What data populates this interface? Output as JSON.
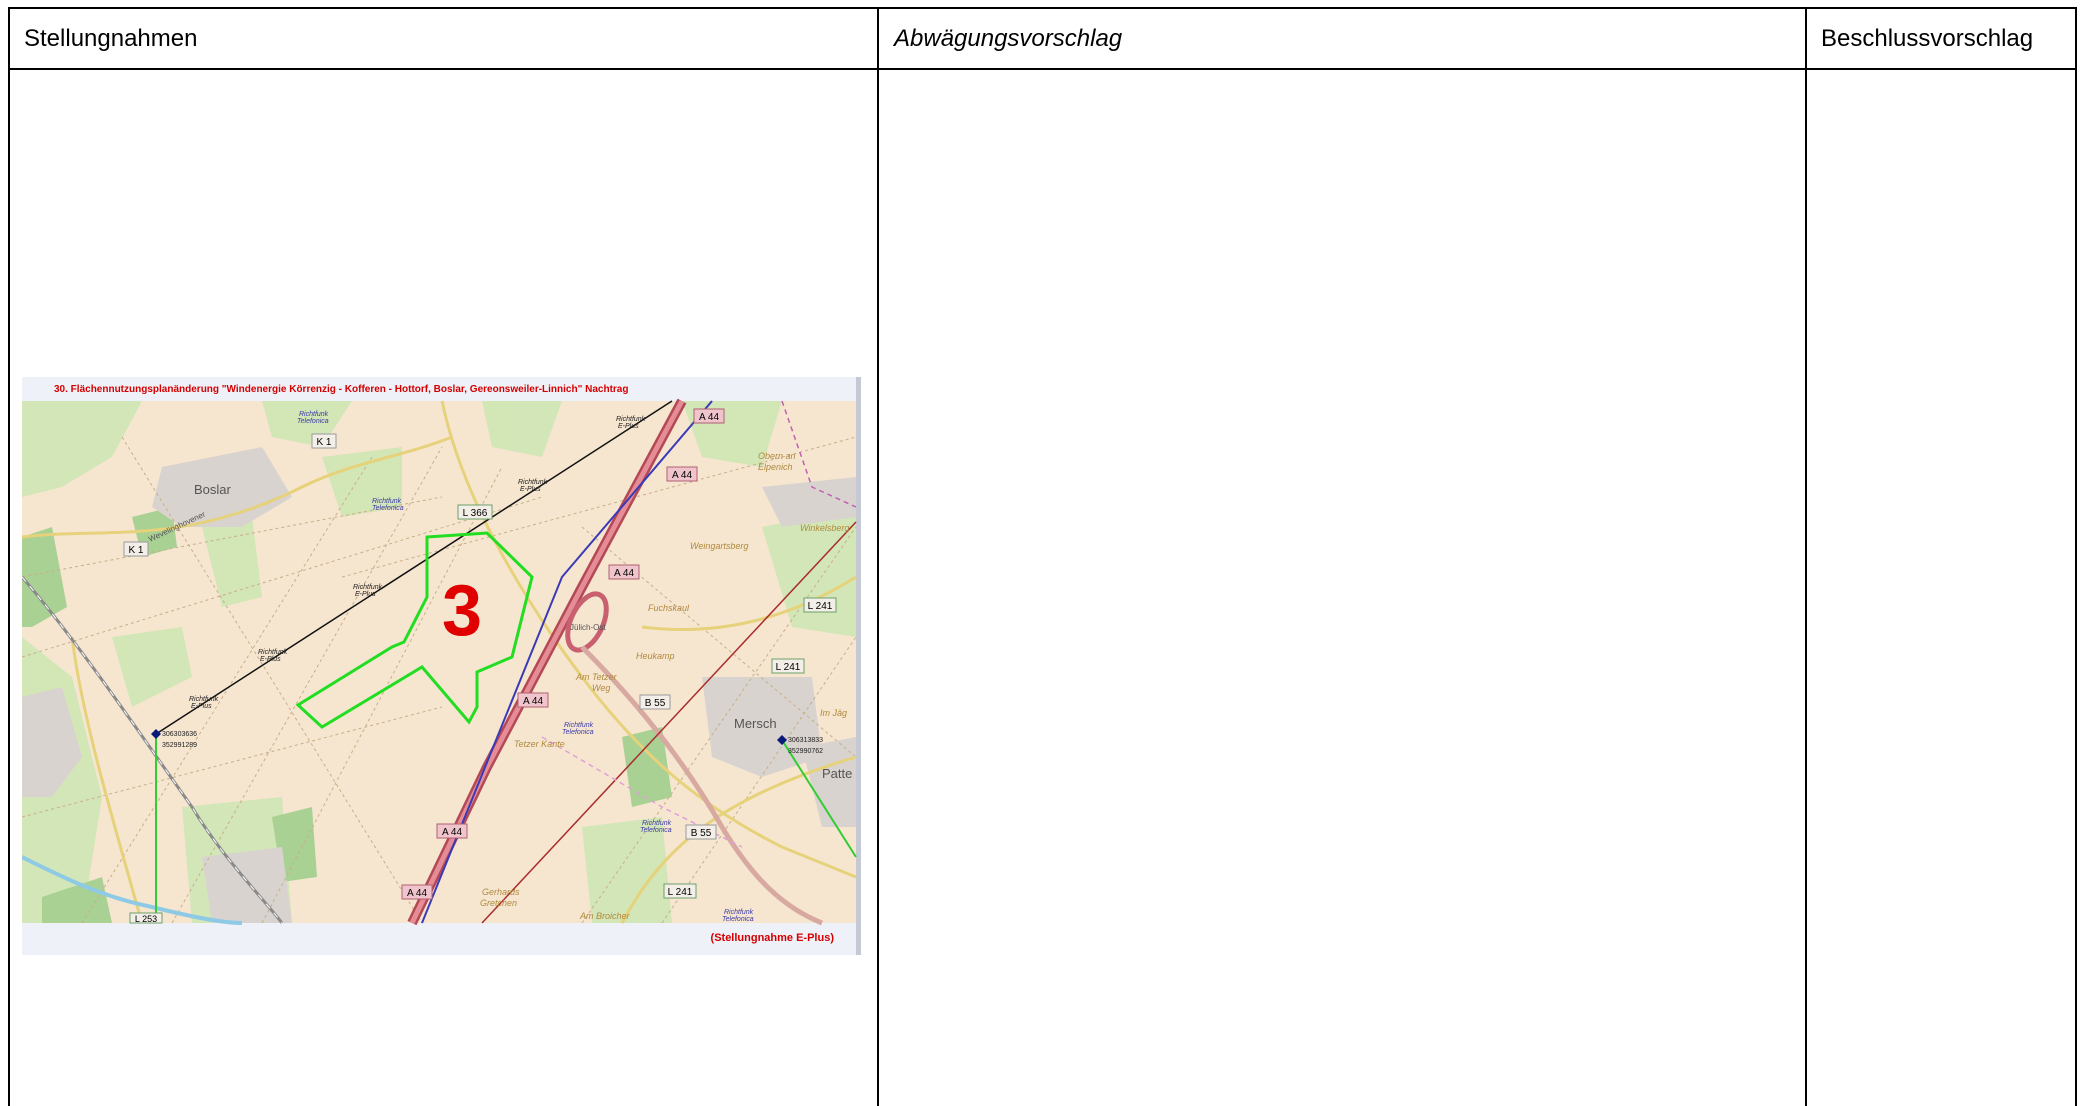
{
  "table": {
    "headers": {
      "stellungnahmen": "Stellungnahmen",
      "abwaegungsvorschlag": "Abwägungsvorschlag",
      "beschlussvorschlag": "Beschlussvorschlag"
    }
  },
  "map": {
    "title": "30. Flächennutzungsplanänderung \"Windenergie Körrenzig - Kofferen - Hottorf, Boslar, Gereonsweiler-Linnich\" Nachtrag",
    "caption": "(Stellungnahme E-Plus)",
    "area_number": "3",
    "places": {
      "boslar": "Boslar",
      "mersch": "Mersch",
      "patte": "Patte",
      "obern": "Obern an",
      "elpenich": "Elpenich",
      "winkelsberg": "Winkelsberg",
      "weingartsberg": "Weingartsberg",
      "fuchskaul": "Fuchskaul",
      "heukamp": "Heukamp",
      "am_tetzer_weg": "Am Tetzer",
      "weg": "Weg",
      "tetzer_kante": "Tetzer Kante",
      "gerhards": "Gerhards",
      "gretchen": "Gretchen",
      "am_broicher": "Am Broicher",
      "im_jaeg": "Im Jäg",
      "wevelinghovener": "Wevelinghovener",
      "juelich_ost": "Jülich-Ost"
    },
    "roads": {
      "k1_a": "K 1",
      "k1_b": "K 1",
      "l366": "L 366",
      "a44_1": "A 44",
      "a44_2": "A 44",
      "a44_3": "A 44",
      "a44_4": "A 44",
      "a44_5": "A 44",
      "a44_6": "A 44",
      "b55_1": "B 55",
      "b55_2": "B 55",
      "l241_1": "L 241",
      "l241_2": "L 241",
      "l241_3": "L 241",
      "l253": "L 253"
    },
    "links": {
      "rt1a": "Richtfunk",
      "rt1b": "Telefonica",
      "rt2a": "Richtfunk",
      "rt2b": "Telefonica",
      "rt3a": "Richtfunk",
      "rt3b": "Telefonica",
      "rt4a": "Richtfunk",
      "rt4b": "Telefonica",
      "rt5a": "Richtfunk",
      "rt5b": "Telefonica",
      "re1a": "Richtfunk",
      "re1b": "E-Plus",
      "re2a": "Richtfunk",
      "re2b": "E-Plus",
      "re3a": "Richtfunk",
      "re3b": "E-Plus",
      "re4a": "Richtfunk",
      "re4b": "E-Plus",
      "re5a": "Richtfunk",
      "re5b": "E-Plus"
    },
    "points": {
      "left_id": "306303636",
      "left_val": "352991289",
      "right_id": "306313833",
      "right_val": "352990762"
    },
    "colors": {
      "title": "#d40000",
      "number": "#e00000",
      "area_outline": "#22dd22",
      "motorway": "#c0505a",
      "base": "#f6e6d0"
    }
  }
}
